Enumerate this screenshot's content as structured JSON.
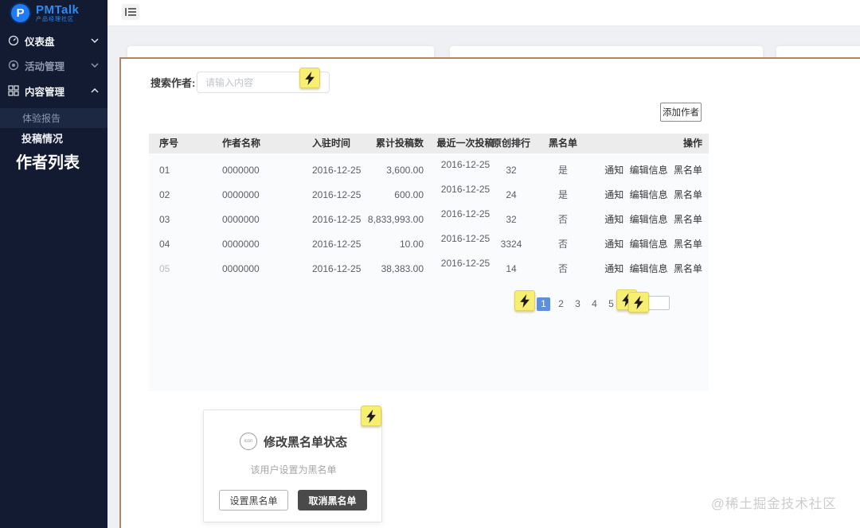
{
  "sidebar": {
    "logo": {
      "name": "PMTalk",
      "subtitle": "产品经理社区",
      "monogram": "P"
    },
    "menu": [
      {
        "label": "仪表盘"
      },
      {
        "label": "活动管理"
      },
      {
        "label": "内容管理"
      }
    ],
    "submenu": [
      {
        "label": "体验报告"
      },
      {
        "label": "投稿情况"
      }
    ],
    "active_page": "作者列表"
  },
  "search": {
    "label": "搜索作者:",
    "placeholder": "请输入内容"
  },
  "toolbar": {
    "add_author": "添加作者"
  },
  "table": {
    "headers": {
      "no": "序号",
      "name": "作者名称",
      "join": "入驻时间",
      "total": "累计投稿数",
      "last": "最近一次投稿",
      "rank": "原创排行",
      "blacklist": "黑名单",
      "ops": "操作"
    },
    "rows": [
      {
        "no": "01",
        "name": "0000000",
        "join": "2016-12-25",
        "total": "3,600.00",
        "last": "2016-12-25",
        "rank": "32",
        "blacklist": "是",
        "actions": [
          "通知",
          "编辑信息",
          "黑名单"
        ]
      },
      {
        "no": "02",
        "name": "0000000",
        "join": "2016-12-25",
        "total": "600.00",
        "last": "2016-12-25",
        "rank": "24",
        "blacklist": "是",
        "actions": [
          "通知",
          "编辑信息",
          "黑名单"
        ]
      },
      {
        "no": "03",
        "name": "0000000",
        "join": "2016-12-25",
        "total": "8,833,993.00",
        "last": "2016-12-25",
        "rank": "32",
        "blacklist": "否",
        "actions": [
          "通知",
          "编辑信息",
          "黑名单"
        ]
      },
      {
        "no": "04",
        "name": "0000000",
        "join": "2016-12-25",
        "total": "10.00",
        "last": "2016-12-25",
        "rank": "3324",
        "blacklist": "否",
        "actions": [
          "通知",
          "编辑信息",
          "黑名单"
        ]
      },
      {
        "no": "05",
        "name": "0000000",
        "join": "2016-12-25",
        "total": "38,383.00",
        "last": "2016-12-25",
        "rank": "14",
        "blacklist": "否",
        "actions": [
          "通知",
          "编辑信息",
          "黑名单"
        ]
      }
    ]
  },
  "pagination": {
    "active_page": "1",
    "pages": [
      "1",
      "2",
      "3",
      "4",
      "5"
    ]
  },
  "modal": {
    "icon_label": "icon",
    "title": "修改黑名单状态",
    "subtitle": "该用户设置为黑名单",
    "set_button": "设置黑名单",
    "cancel_button": "取消黑名单"
  },
  "watermark": "@稀土掘金技术社区",
  "colors": {
    "sidebar_bg": "#121b32",
    "logo_blue": "#2d8cf0",
    "panel_border": "#b08565",
    "table_header_bg": "#ececec",
    "hotspot_yellow": "#f8ee71",
    "pagination_active_blue": "#5f8fdb",
    "dark_button": "#4a4a4a"
  }
}
